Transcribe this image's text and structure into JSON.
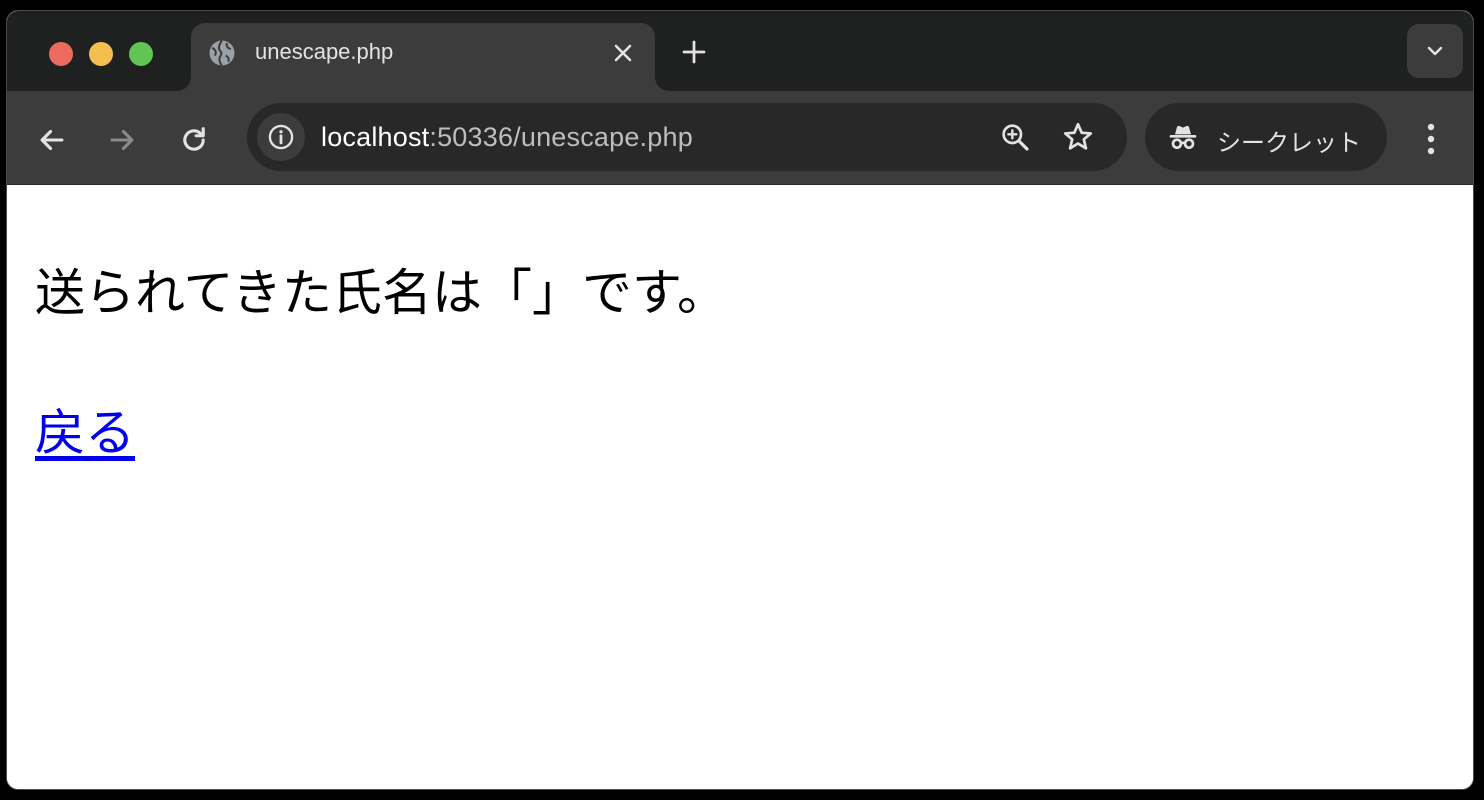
{
  "browser": {
    "tab": {
      "title": "unescape.php",
      "favicon": "globe-icon"
    },
    "toolbar": {
      "url_host": "localhost",
      "url_rest": ":50336/unescape.php",
      "incognito_label": "シークレット"
    }
  },
  "page": {
    "message": "送られてきた氏名は「」です。",
    "back_link": "戻る"
  },
  "colors": {
    "link": "#0000ee",
    "tabstrip": "#1f2020",
    "toolbar": "#3c3c3c"
  }
}
